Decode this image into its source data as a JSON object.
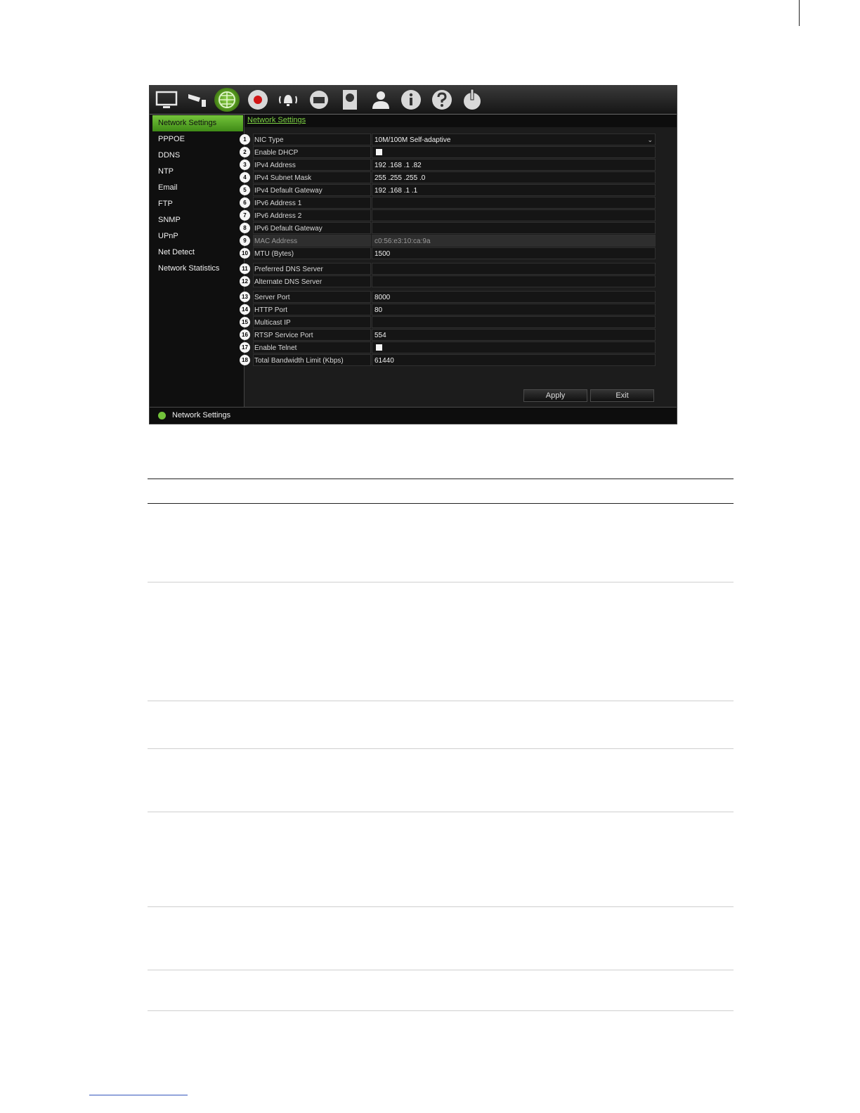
{
  "toolbar": {
    "icons": [
      "monitor-icon",
      "camera-icon",
      "network-icon",
      "record-icon",
      "alarm-icon",
      "device-icon",
      "hdd-icon",
      "user-icon",
      "info-icon",
      "help-icon",
      "power-icon"
    ],
    "active": "network-icon",
    "accent": "#7ed344"
  },
  "sidebar": {
    "items": [
      {
        "label": "Network Settings",
        "active": true
      },
      {
        "label": "PPPOE"
      },
      {
        "label": "DDNS"
      },
      {
        "label": "NTP"
      },
      {
        "label": "Email"
      },
      {
        "label": "FTP"
      },
      {
        "label": "SNMP"
      },
      {
        "label": "UPnP"
      },
      {
        "label": "Net Detect"
      },
      {
        "label": "Network Statistics"
      }
    ]
  },
  "main": {
    "breadcrumb": "Network Settings",
    "fields": [
      {
        "num": "1",
        "label": "NIC Type",
        "value": "10M/100M Self-adaptive",
        "type": "select"
      },
      {
        "num": "2",
        "label": "Enable DHCP",
        "value": "",
        "type": "checkbox"
      },
      {
        "num": "3",
        "label": "IPv4 Address",
        "value": "192 .168 .1     .82"
      },
      {
        "num": "4",
        "label": "IPv4 Subnet Mask",
        "value": "255 .255 .255 .0"
      },
      {
        "num": "5",
        "label": "IPv4 Default Gateway",
        "value": "192 .168 .1     .1"
      },
      {
        "num": "6",
        "label": "IPv6 Address 1",
        "value": ""
      },
      {
        "num": "7",
        "label": "IPv6 Address 2",
        "value": ""
      },
      {
        "num": "8",
        "label": "IPv6 Default Gateway",
        "value": ""
      },
      {
        "num": "9",
        "label": "MAC Address",
        "value": "c0:56:e3:10:ca:9a",
        "dim": true
      },
      {
        "num": "10",
        "label": "MTU (Bytes)",
        "value": "1500",
        "gap": true
      },
      {
        "num": "11",
        "label": "Preferred DNS Server",
        "value": ""
      },
      {
        "num": "12",
        "label": "Alternate DNS Server",
        "value": "",
        "gap": true
      },
      {
        "num": "13",
        "label": "Server Port",
        "value": "8000"
      },
      {
        "num": "14",
        "label": "HTTP Port",
        "value": "80"
      },
      {
        "num": "15",
        "label": "Multicast IP",
        "value": ""
      },
      {
        "num": "16",
        "label": "RTSP Service Port",
        "value": "554"
      },
      {
        "num": "17",
        "label": "Enable Telnet",
        "value": "",
        "type": "checkbox"
      },
      {
        "num": "18",
        "label": "Total Bandwidth Limit (Kbps)",
        "value": "61440"
      }
    ],
    "apply_label": "Apply",
    "exit_label": "Exit"
  },
  "status": {
    "text": "Network Settings"
  }
}
